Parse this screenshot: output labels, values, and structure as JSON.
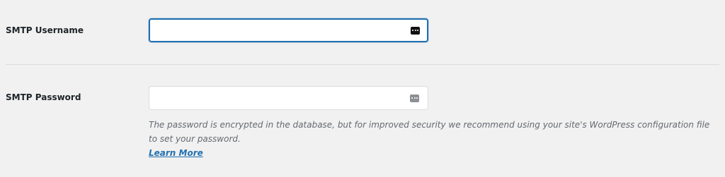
{
  "settings": {
    "smtp_username": {
      "label": "SMTP Username",
      "value": "",
      "icon": "password-manager-icon"
    },
    "smtp_password": {
      "label": "SMTP Password",
      "value": "",
      "icon": "password-manager-icon",
      "description": "The password is encrypted in the database, but for improved security we recommend using your site's WordPress configuration file to set your password.",
      "link_text": "Learn More"
    }
  },
  "colors": {
    "background": "#f1f1f1",
    "focus_border": "#2271b1",
    "link": "#2271b1",
    "description_text": "#646970",
    "divider": "#dcdcde"
  }
}
